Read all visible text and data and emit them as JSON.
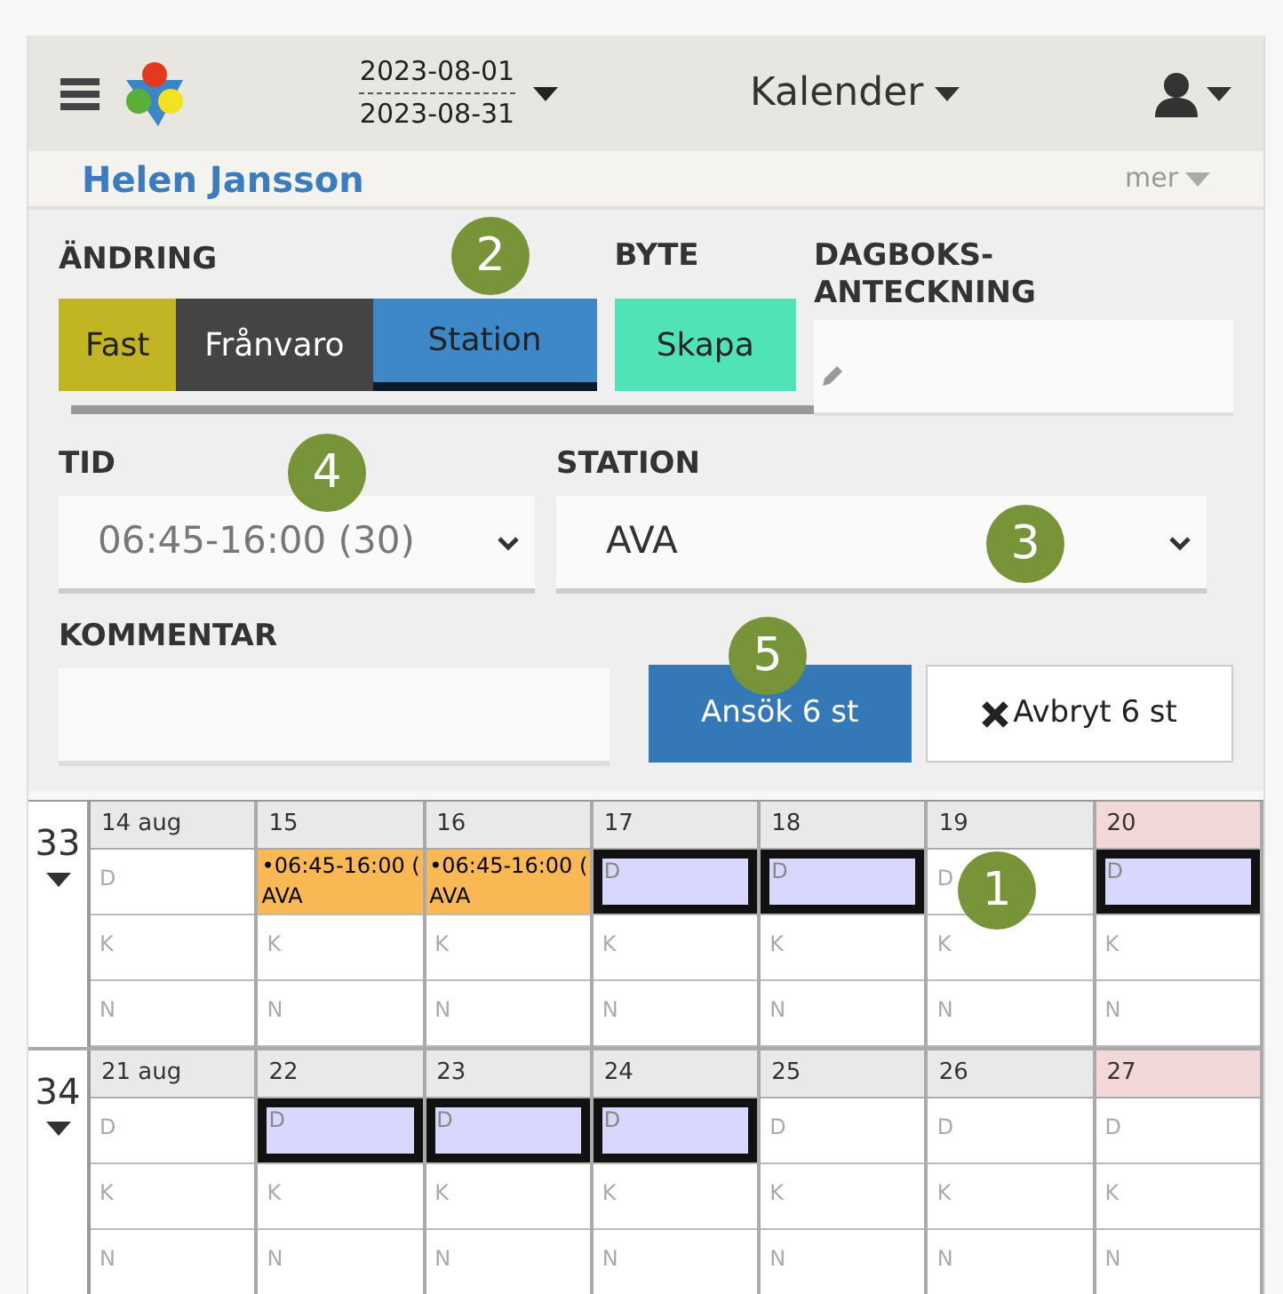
{
  "header": {
    "date_from": "2023-08-01",
    "date_to": "2023-08-31",
    "view": "Kalender"
  },
  "user_bar": {
    "name": "Helen Jansson",
    "more": "mer"
  },
  "change": {
    "title": "ÄNDRING",
    "tabs": [
      {
        "label": "Fast",
        "color": "#c2b524",
        "selected": false
      },
      {
        "label": "Frånvaro",
        "color": "#444444",
        "selected": false
      },
      {
        "label": "Station",
        "color": "#3f88c8",
        "selected": true
      }
    ]
  },
  "swap": {
    "title": "BYTE",
    "button": "Skapa"
  },
  "diary": {
    "title": "DAGBOKS-\nANTECKNING"
  },
  "time": {
    "title": "TID",
    "value": "06:45-16:00 (30)"
  },
  "station": {
    "title": "STATION",
    "value": "AVA"
  },
  "comment": {
    "title": "KOMMENTAR"
  },
  "apply_button": "Ansök 6 st",
  "cancel_button": "Avbryt 6 st",
  "weeks": [
    {
      "number": "33",
      "days": [
        {
          "date": "14 aug",
          "weekend": false,
          "slots": [
            {
              "label": "D",
              "kind": "empty"
            },
            {
              "label": "K",
              "kind": "empty"
            },
            {
              "label": "N",
              "kind": "empty"
            }
          ]
        },
        {
          "date": "15",
          "weekend": false,
          "slots": [
            {
              "kind": "event",
              "lines": [
                "•06:45-16:00 (",
                "AVA"
              ]
            },
            {
              "label": "K",
              "kind": "empty"
            },
            {
              "label": "N",
              "kind": "empty"
            }
          ]
        },
        {
          "date": "16",
          "weekend": false,
          "slots": [
            {
              "kind": "event",
              "lines": [
                "•06:45-16:00 (",
                "AVA"
              ]
            },
            {
              "label": "K",
              "kind": "empty"
            },
            {
              "label": "N",
              "kind": "empty"
            }
          ]
        },
        {
          "date": "17",
          "weekend": false,
          "slots": [
            {
              "label": "D",
              "kind": "selected"
            },
            {
              "label": "K",
              "kind": "empty"
            },
            {
              "label": "N",
              "kind": "empty"
            }
          ]
        },
        {
          "date": "18",
          "weekend": false,
          "slots": [
            {
              "label": "D",
              "kind": "selected"
            },
            {
              "label": "K",
              "kind": "empty"
            },
            {
              "label": "N",
              "kind": "empty"
            }
          ]
        },
        {
          "date": "19",
          "weekend": false,
          "slots": [
            {
              "label": "D",
              "kind": "empty"
            },
            {
              "label": "K",
              "kind": "empty"
            },
            {
              "label": "N",
              "kind": "empty"
            }
          ]
        },
        {
          "date": "20",
          "weekend": true,
          "slots": [
            {
              "label": "D",
              "kind": "selected"
            },
            {
              "label": "K",
              "kind": "empty"
            },
            {
              "label": "N",
              "kind": "empty"
            }
          ]
        }
      ]
    },
    {
      "number": "34",
      "days": [
        {
          "date": "21 aug",
          "weekend": false,
          "slots": [
            {
              "label": "D",
              "kind": "empty"
            },
            {
              "label": "K",
              "kind": "empty"
            },
            {
              "label": "N",
              "kind": "empty"
            }
          ]
        },
        {
          "date": "22",
          "weekend": false,
          "slots": [
            {
              "label": "D",
              "kind": "selected"
            },
            {
              "label": "K",
              "kind": "empty"
            },
            {
              "label": "N",
              "kind": "empty"
            }
          ]
        },
        {
          "date": "23",
          "weekend": false,
          "slots": [
            {
              "label": "D",
              "kind": "selected"
            },
            {
              "label": "K",
              "kind": "empty"
            },
            {
              "label": "N",
              "kind": "empty"
            }
          ]
        },
        {
          "date": "24",
          "weekend": false,
          "slots": [
            {
              "label": "D",
              "kind": "selected"
            },
            {
              "label": "K",
              "kind": "empty"
            },
            {
              "label": "N",
              "kind": "empty"
            }
          ]
        },
        {
          "date": "25",
          "weekend": false,
          "slots": [
            {
              "label": "D",
              "kind": "empty"
            },
            {
              "label": "K",
              "kind": "empty"
            },
            {
              "label": "N",
              "kind": "empty"
            }
          ]
        },
        {
          "date": "26",
          "weekend": false,
          "slots": [
            {
              "label": "D",
              "kind": "empty"
            },
            {
              "label": "K",
              "kind": "empty"
            },
            {
              "label": "N",
              "kind": "empty"
            }
          ]
        },
        {
          "date": "27",
          "weekend": true,
          "slots": [
            {
              "label": "D",
              "kind": "empty"
            },
            {
              "label": "K",
              "kind": "empty"
            },
            {
              "label": "N",
              "kind": "empty"
            }
          ]
        }
      ]
    }
  ],
  "markers": [
    "1",
    "2",
    "3",
    "4",
    "5"
  ]
}
